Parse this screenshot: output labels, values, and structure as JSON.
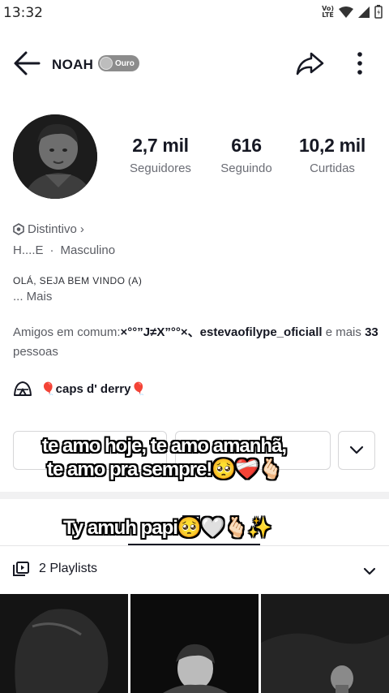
{
  "status_bar": {
    "time": "13:32",
    "network": "VoLTE",
    "icons": [
      "volte-icon",
      "wifi-icon",
      "signal-icon",
      "battery-icon"
    ]
  },
  "header": {
    "username": "NOAH",
    "badge_label": "Ouro",
    "icons": [
      "back-arrow-icon",
      "share-icon",
      "more-vert-icon"
    ]
  },
  "stats": [
    {
      "value": "2,7 mil",
      "label": "Seguidores"
    },
    {
      "value": "616",
      "label": "Seguindo"
    },
    {
      "value": "10,2 mil",
      "label": "Curtidas"
    }
  ],
  "bio": {
    "distintivo": "Distintivo",
    "distintivo_chevron": "›",
    "name_short": "H....E",
    "separator": "·",
    "gender": "Masculino",
    "welcome": "OLÁ, SEJA BEM VINDO (A)",
    "more": "... Mais",
    "mutual_prefix": "Amigos em comum:",
    "mutual_friend1": "×°°”J≠X”°°×、",
    "mutual_friend2": "estevaofilype_oficiall",
    "mutual_mid": " e mais ",
    "mutual_count": "33",
    "mutual_suffix": " pessoas",
    "group_name": "🎈caps d' derry🎈"
  },
  "captions": {
    "line1": "te amo hoje, te amo amanhã,",
    "line2": "te amo pra sempre!🥺❤️‍🩹🫰🏻",
    "line3": "Ty amuh papi🥺🤍🫰🏻✨"
  },
  "playlists": {
    "label": "2 Playlists"
  },
  "colors": {
    "text": "#161823",
    "muted": "#5a5c63",
    "badge": "#8c8c8c"
  }
}
